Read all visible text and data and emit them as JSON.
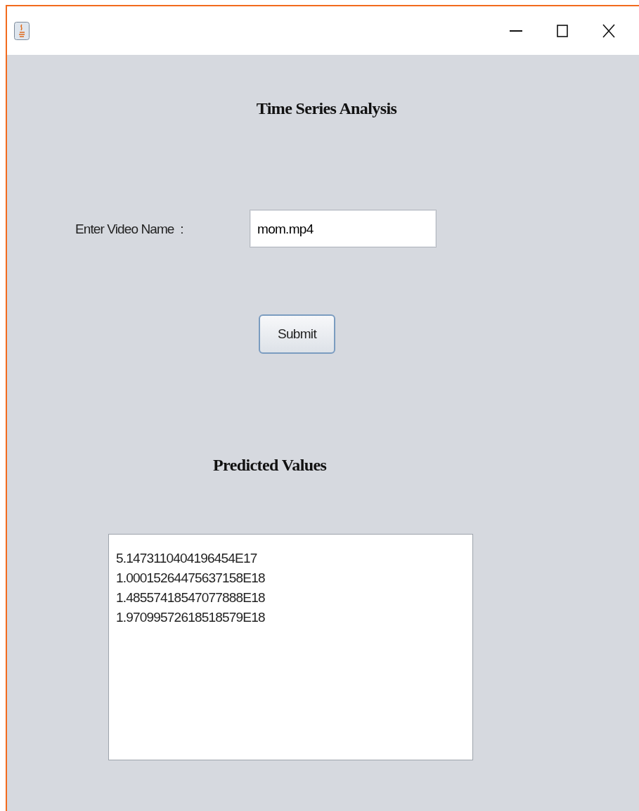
{
  "window": {
    "title_bar_buttons": [
      {
        "kind": "minimize"
      },
      {
        "kind": "maximize"
      },
      {
        "kind": "close"
      }
    ]
  },
  "heading": "Time Series Analysis",
  "video_field": {
    "label": "Enter Video Name  :",
    "value": "mom.mp4"
  },
  "submit_button": "Submit",
  "results": {
    "heading": "Predicted Values",
    "lines": [
      "5.1473110404196454E17",
      "1.00015264475637158E18",
      "1.48557418547077888E18",
      "1.97099572618518579E18"
    ]
  }
}
